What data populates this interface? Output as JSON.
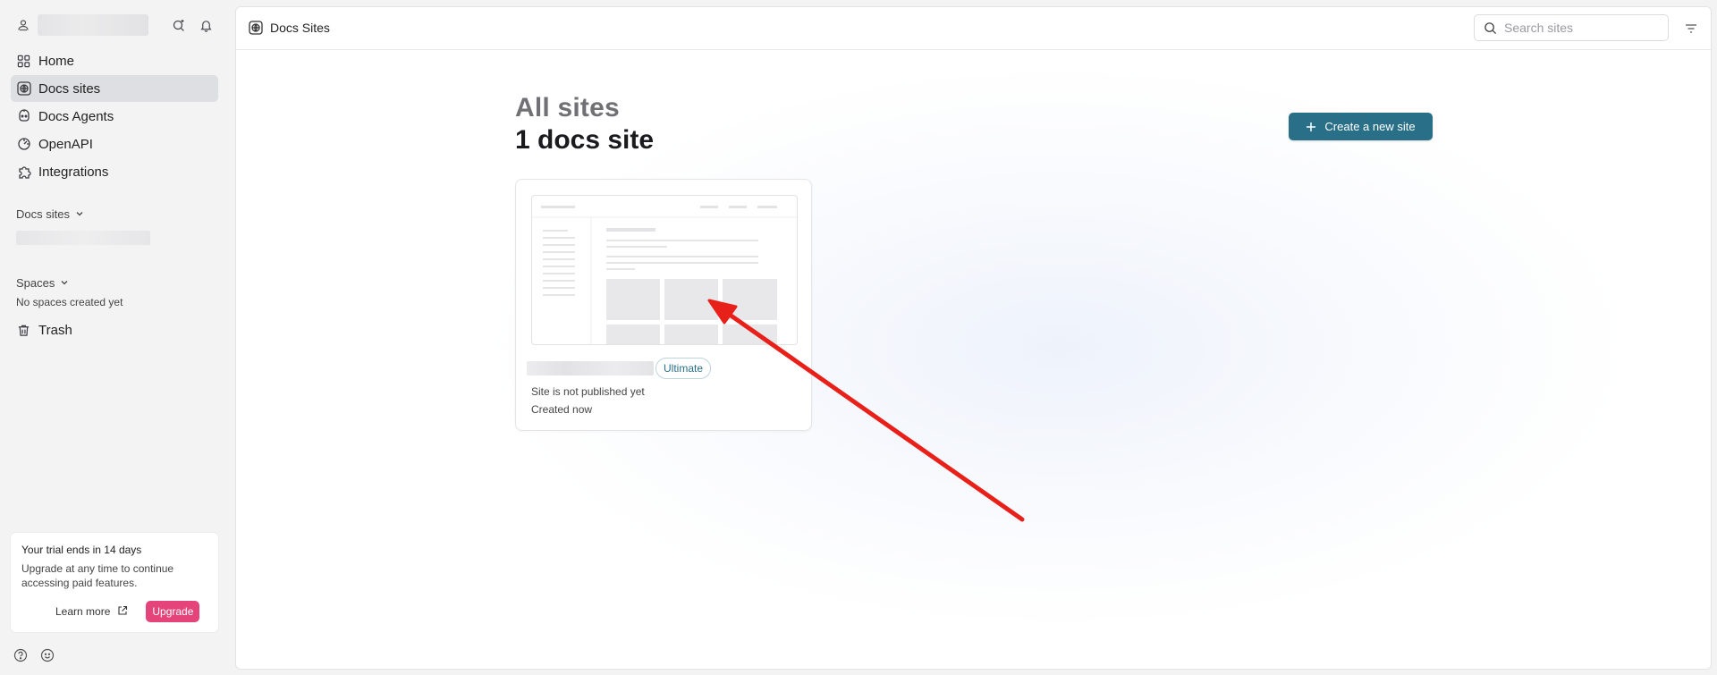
{
  "sidebar": {
    "nav": [
      {
        "label": "Home",
        "icon": "grid-icon"
      },
      {
        "label": "Docs sites",
        "icon": "globe-icon",
        "active": true
      },
      {
        "label": "Docs Agents",
        "icon": "agent-icon"
      },
      {
        "label": "OpenAPI",
        "icon": "openapi-icon"
      },
      {
        "label": "Integrations",
        "icon": "puzzle-icon"
      }
    ],
    "docs_sites_header": "Docs sites",
    "spaces_header": "Spaces",
    "no_spaces": "No spaces created yet",
    "trash": "Trash"
  },
  "trial": {
    "title": "Your trial ends in 14 days",
    "body": "Upgrade at any time to continue accessing paid features.",
    "learn_more": "Learn more",
    "upgrade": "Upgrade"
  },
  "topbar": {
    "title": "Docs Sites",
    "search_placeholder": "Search sites"
  },
  "main": {
    "heading_all": "All sites",
    "heading_count": "1 docs site",
    "create_button": "Create a new site"
  },
  "site_card": {
    "badge": "Ultimate",
    "status": "Site is not published yet",
    "created": "Created now"
  },
  "colors": {
    "accent": "#2a6f88",
    "upgrade": "#e5447a",
    "annotation_arrow": "#e8201a"
  }
}
